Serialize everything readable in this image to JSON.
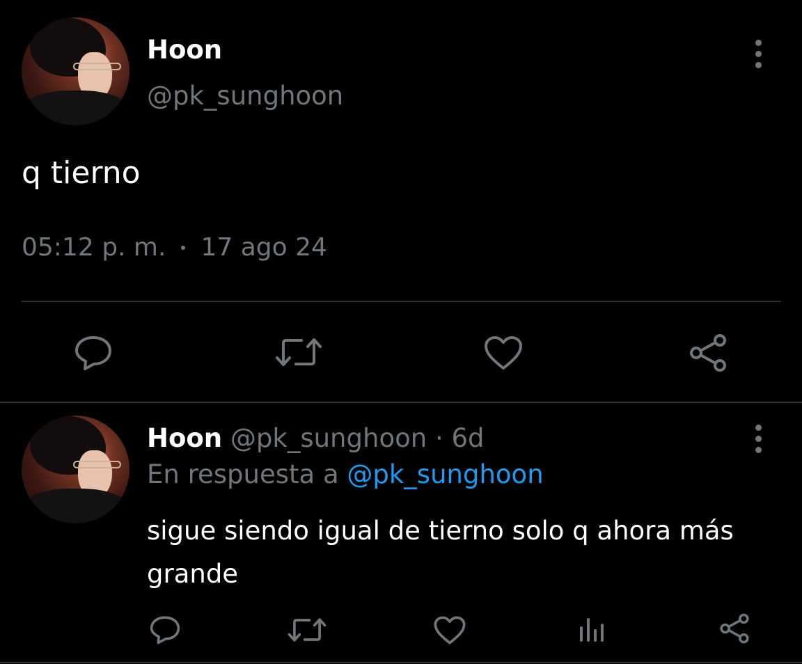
{
  "main_tweet": {
    "author_name": "Hoon",
    "author_handle": "@pk_sunghoon",
    "text": "q tierno",
    "time": "05:12 p. m.",
    "date": "17 ago 24"
  },
  "reply": {
    "author_name": "Hoon",
    "author_handle": "@pk_sunghoon",
    "separator": "·",
    "age": "6d",
    "reply_prefix": "En respuesta a",
    "reply_to": "@pk_sunghoon",
    "text_line1": "sigue siendo igual de tierno solo q ahora más",
    "text_line2": "grande"
  },
  "icons": {
    "more": "more-vertical-icon",
    "reply": "reply-icon",
    "retweet": "retweet-icon",
    "like": "heart-icon",
    "share": "share-icon",
    "views": "views-icon"
  },
  "colors": {
    "background": "#000000",
    "text_primary": "#ffffff",
    "text_secondary": "#71767b",
    "link": "#1d9bf0",
    "divider": "#2f3336"
  }
}
